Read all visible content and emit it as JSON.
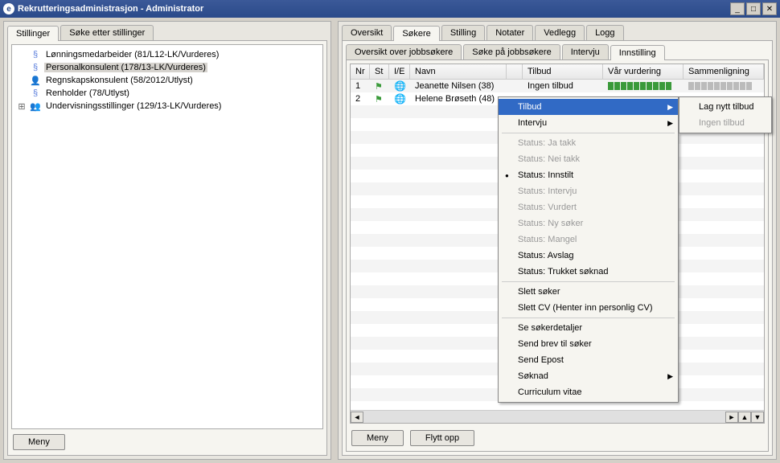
{
  "window": {
    "title": "Rekrutteringsadministrasjon - Administrator",
    "icon_letter": "e"
  },
  "left": {
    "tabs": [
      "Stillinger",
      "Søke etter stillinger"
    ],
    "active_tab": 0,
    "tree": [
      {
        "icon": "section",
        "label": "Lønningsmedarbeider (81/L12-LK/Vurderes)"
      },
      {
        "icon": "section",
        "label": "Personalkonsulent (178/13-LK/Vurderes)",
        "selected": true
      },
      {
        "icon": "person",
        "label": "Regnskapskonsulent (58/2012/Utlyst)"
      },
      {
        "icon": "section",
        "label": "Renholder (78/Utlyst)"
      },
      {
        "icon": "group",
        "label": "Undervisningsstillinger (129/13-LK/Vurderes)",
        "expandable": true
      }
    ],
    "menu_button": "Meny"
  },
  "right": {
    "tabs": [
      "Oversikt",
      "Søkere",
      "Stilling",
      "Notater",
      "Vedlegg",
      "Logg"
    ],
    "active_tab": 1,
    "subtabs": [
      "Oversikt over jobbsøkere",
      "Søke på jobbsøkere",
      "Intervju",
      "Innstilling"
    ],
    "active_subtab": 3,
    "columns": {
      "nr": "Nr",
      "st": "St",
      "ie": "I/E",
      "navn": "Navn",
      "tilbud": "Tilbud",
      "vur": "Vår vurdering",
      "sam": "Sammenligning"
    },
    "rows": [
      {
        "nr": "1",
        "navn": "Jeanette Nilsen (38)",
        "tilbud": "Ingen tilbud",
        "rating_green": 10,
        "rating_grey": 0,
        "sam_green": 0,
        "sam_grey": 10
      },
      {
        "nr": "2",
        "navn": "Helene Brøseth (48)",
        "tilbud": "",
        "rating_green": 0,
        "rating_grey": 0,
        "sam_green": 0,
        "sam_grey": 0
      }
    ],
    "buttons": {
      "meny": "Meny",
      "flytt": "Flytt opp"
    }
  },
  "context_menu": {
    "items": [
      {
        "label": "Tilbud",
        "submenu": true,
        "highlighted": true
      },
      {
        "label": "Intervju",
        "submenu": true
      },
      {
        "sep": true
      },
      {
        "label": "Status: Ja takk",
        "disabled": true
      },
      {
        "label": "Status: Nei takk",
        "disabled": true
      },
      {
        "label": "Status: Innstilt",
        "bullet": true
      },
      {
        "label": "Status: Intervju",
        "disabled": true
      },
      {
        "label": "Status: Vurdert",
        "disabled": true
      },
      {
        "label": "Status: Ny søker",
        "disabled": true
      },
      {
        "label": "Status: Mangel",
        "disabled": true
      },
      {
        "label": "Status: Avslag"
      },
      {
        "label": "Status: Trukket søknad"
      },
      {
        "sep": true
      },
      {
        "label": "Slett søker"
      },
      {
        "label": "Slett CV (Henter inn personlig CV)"
      },
      {
        "sep": true
      },
      {
        "label": "Se søkerdetaljer"
      },
      {
        "label": "Send brev til søker"
      },
      {
        "label": "Send Epost"
      },
      {
        "label": "Søknad",
        "submenu": true
      },
      {
        "label": "Curriculum vitae"
      }
    ],
    "submenu": [
      {
        "label": "Lag nytt tilbud"
      },
      {
        "label": "Ingen tilbud",
        "disabled": true
      }
    ]
  }
}
